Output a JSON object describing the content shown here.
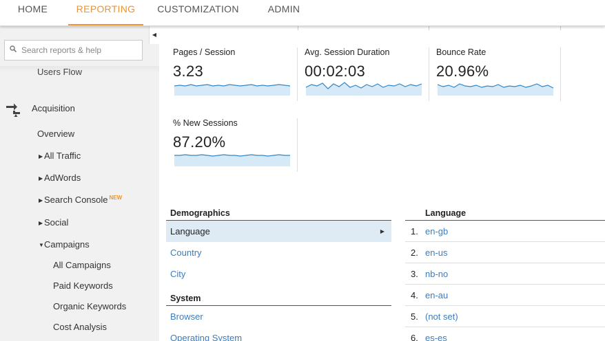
{
  "nav": {
    "tabs": [
      {
        "label": "HOME"
      },
      {
        "label": "REPORTING"
      },
      {
        "label": "CUSTOMIZATION"
      },
      {
        "label": "ADMIN"
      }
    ],
    "active": "REPORTING",
    "accent_color": "#f0932e"
  },
  "sidebar": {
    "search_placeholder": "Search reports & help",
    "users_flow": "Users Flow",
    "acquisition": "Acquisition",
    "items": [
      {
        "label": "Overview"
      },
      {
        "label": "All Traffic"
      },
      {
        "label": "AdWords"
      },
      {
        "label": "Search Console",
        "badge": "NEW"
      },
      {
        "label": "Social"
      },
      {
        "label": "Campaigns"
      },
      {
        "label": "All Campaigns"
      },
      {
        "label": "Paid Keywords"
      },
      {
        "label": "Organic Keywords"
      },
      {
        "label": "Cost Analysis"
      }
    ]
  },
  "metrics": [
    {
      "label": "Pages / Session",
      "value": "3.23"
    },
    {
      "label": "Avg. Session Duration",
      "value": "00:02:03"
    },
    {
      "label": "Bounce Rate",
      "value": "20.96%"
    },
    {
      "label": "% New Sessions",
      "value": "87.20%"
    }
  ],
  "demographics": {
    "title": "Demographics",
    "links": [
      "Language",
      "Country",
      "City"
    ]
  },
  "system": {
    "title": "System",
    "links": [
      "Browser",
      "Operating System"
    ]
  },
  "language_table": {
    "title": "Language",
    "rows": [
      {
        "num": "1.",
        "name": "en-gb"
      },
      {
        "num": "2.",
        "name": "en-us"
      },
      {
        "num": "3.",
        "name": "nb-no"
      },
      {
        "num": "4.",
        "name": "en-au"
      },
      {
        "num": "5.",
        "name": "(not set)"
      },
      {
        "num": "6.",
        "name": "es-es"
      }
    ]
  },
  "colors": {
    "link": "#3b7dbd",
    "sparkline": "#2f86c8",
    "sparkline_fill": "#d6e9f6",
    "selected_row": "#deebf5"
  }
}
